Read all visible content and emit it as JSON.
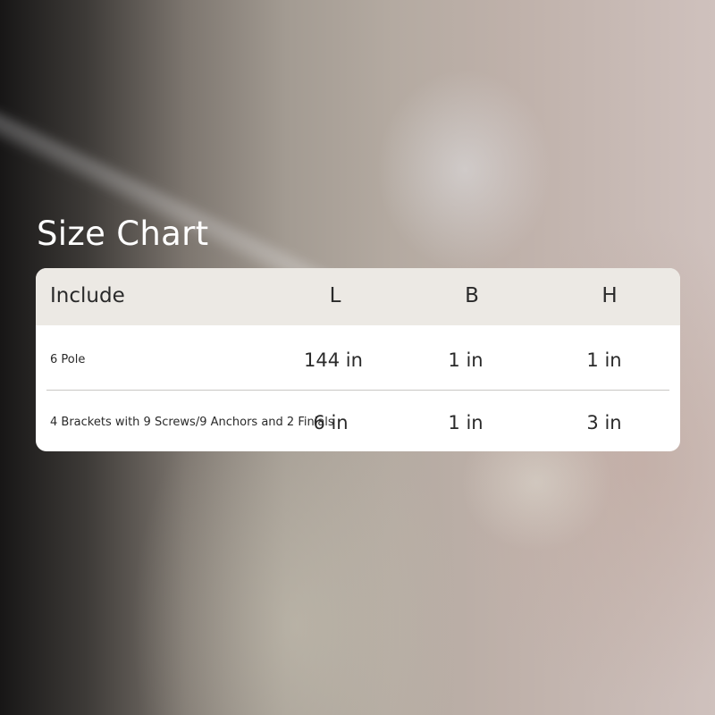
{
  "title": "Size Chart",
  "table": {
    "headers": [
      "Include",
      "L",
      "B",
      "H"
    ],
    "rows": [
      {
        "include": "6 Pole",
        "L": "144 in",
        "B": "1 in",
        "H": "1 in"
      },
      {
        "include": "4 Brackets with 9 Screws/9 Anchors and 2 Finials",
        "L": "6 in",
        "B": "1 in",
        "H": "3 in"
      }
    ]
  },
  "colors": {
    "header_bg": "#ece9e4",
    "card_bg": "#ffffff",
    "title_text": "#ffffff",
    "body_text": "#2a2a2a"
  }
}
